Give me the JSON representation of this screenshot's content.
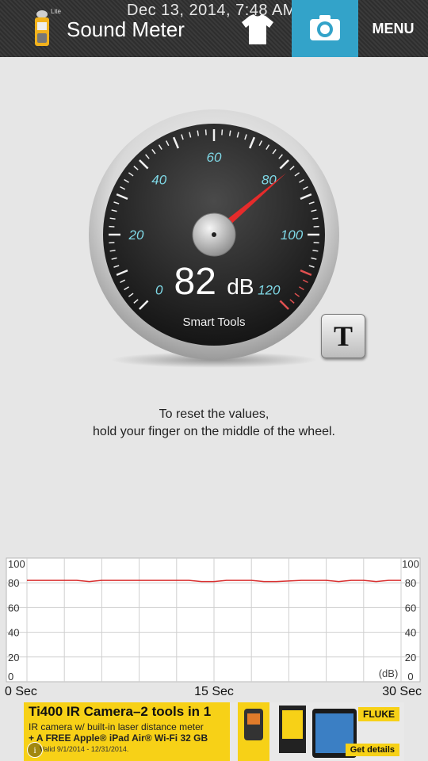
{
  "header": {
    "app_title": "Sound Meter",
    "lite_tag": "Lite",
    "timestamp": "Dec 13, 2014, 7:48 AM",
    "menu_label": "MENU"
  },
  "gauge": {
    "value": 82,
    "unit": "dB",
    "brand": "Smart Tools",
    "scale_min": 0,
    "scale_max": 120,
    "scale_labels": [
      "0",
      "20",
      "40",
      "60",
      "80",
      "100",
      "120"
    ],
    "t_button_label": "T"
  },
  "reset_hint": {
    "line1": "To reset the values,",
    "line2": "hold your finger on the middle of the wheel."
  },
  "chart_data": {
    "type": "line",
    "x": [
      0,
      2,
      4,
      5,
      6,
      8,
      9,
      10,
      12,
      13,
      14,
      15,
      16,
      17,
      18,
      19,
      20,
      22,
      24,
      25,
      26,
      27,
      28,
      29,
      30
    ],
    "series": [
      {
        "values": [
          82,
          82,
          82,
          81,
          82,
          82,
          82,
          82,
          82,
          82,
          81,
          81,
          82,
          82,
          82,
          81,
          81,
          82,
          82,
          81,
          82,
          82,
          81,
          82,
          82
        ]
      }
    ],
    "xlim": [
      0,
      30
    ],
    "ylim": [
      0,
      100
    ],
    "y_ticks": [
      "0",
      "20",
      "40",
      "60",
      "80",
      "100"
    ],
    "x_tick_labels": [
      "0 Sec",
      "15 Sec",
      "30 Sec"
    ],
    "unit_label": "(dB)",
    "grid": true,
    "line_color": "#d93030"
  },
  "ad": {
    "title": "Ti400 IR Camera–2 tools in 1",
    "line1": "IR camera w/ built-in laser distance meter",
    "line2": "+ A FREE Apple® iPad Air® Wi-Fi 32 GB",
    "line3": "Valid 9/1/2014 - 12/31/2014.",
    "brand": "FLUKE",
    "cta": "Get details",
    "info_glyph": "i"
  },
  "icons": {
    "app": "sound-meter-app-icon",
    "shirt": "tshirt-icon",
    "camera": "camera-icon"
  },
  "colors": {
    "accent": "#33a3c9",
    "needle": "#e52b2b",
    "scale_text": "#7fd8e6",
    "red_zone": "#e05050"
  }
}
